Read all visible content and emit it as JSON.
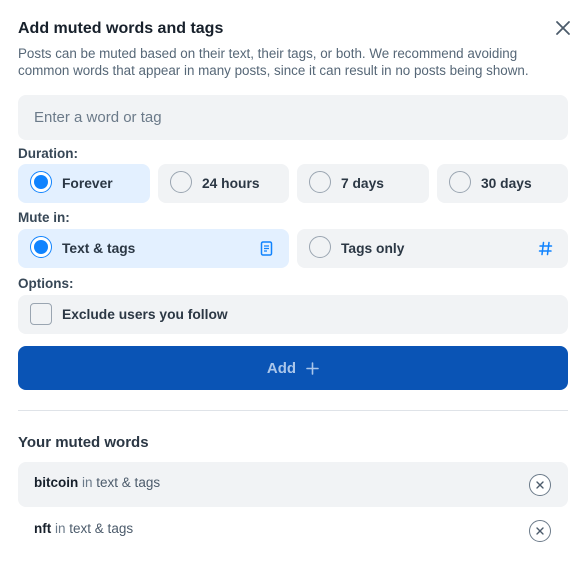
{
  "dialog": {
    "title": "Add muted words and tags",
    "description": "Posts can be muted based on their text, their tags, or both. We recommend avoiding common words that appear in many posts, since it can result in no posts being shown."
  },
  "input": {
    "placeholder": "Enter a word or tag",
    "value": ""
  },
  "duration": {
    "label": "Duration:",
    "selected": "Forever",
    "options": [
      {
        "label": "Forever",
        "selected": true
      },
      {
        "label": "24 hours",
        "selected": false
      },
      {
        "label": "7 days",
        "selected": false
      },
      {
        "label": "30 days",
        "selected": false
      }
    ]
  },
  "mute_in": {
    "label": "Mute in:",
    "options": [
      {
        "label": "Text & tags",
        "selected": true,
        "icon": "document-icon"
      },
      {
        "label": "Tags only",
        "selected": false,
        "icon": "hashtag-icon"
      }
    ]
  },
  "options": {
    "label": "Options:",
    "exclude_following": {
      "label": "Exclude users you follow",
      "checked": false
    }
  },
  "add_button": {
    "label": "Add",
    "icon": "plus-icon"
  },
  "muted_words": {
    "title": "Your muted words",
    "items": [
      {
        "word": "bitcoin",
        "in": "in",
        "where": "text & tags"
      },
      {
        "word": "nft",
        "in": "in",
        "where": "text & tags"
      }
    ]
  },
  "colors": {
    "accent": "#1083fe",
    "button_bg": "#0a54b5",
    "selected_bg": "#e3f0ff",
    "field_bg": "#f1f3f5"
  }
}
